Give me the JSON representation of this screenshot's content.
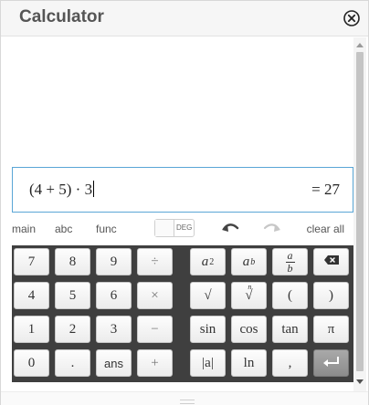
{
  "window": {
    "title": "Calculator"
  },
  "input": {
    "expression": "(4 + 5) · 3",
    "result": "= 27"
  },
  "toolbar": {
    "tabs": [
      "main",
      "abc",
      "func"
    ],
    "deg_label": "DEG",
    "clear_all": "clear all"
  },
  "keypad": {
    "left": [
      [
        "7",
        "8",
        "9",
        "÷"
      ],
      [
        "4",
        "5",
        "6",
        "×"
      ],
      [
        "1",
        "2",
        "3",
        "−"
      ],
      [
        "0",
        ".",
        "ans",
        "+"
      ]
    ],
    "right_row2": [
      "√",
      "(",
      ")"
    ],
    "right_row3": [
      "sin",
      "cos",
      "tan",
      "π"
    ],
    "right_row4": [
      "|a|",
      "ln",
      ","
    ],
    "power_a": "a",
    "power_2": "2",
    "power_b": "b",
    "frac_a": "a",
    "frac_b": "b",
    "nroot_n": "n"
  },
  "colors": {
    "accent_border": "#5aa6d6",
    "keypad_bg": "#3f3f3f",
    "enter_key": "#8c8c8c"
  },
  "icons": [
    "close-circle-icon",
    "undo-icon",
    "redo-icon",
    "backspace-icon",
    "enter-icon",
    "scroll-up-icon",
    "scroll-down-icon"
  ]
}
